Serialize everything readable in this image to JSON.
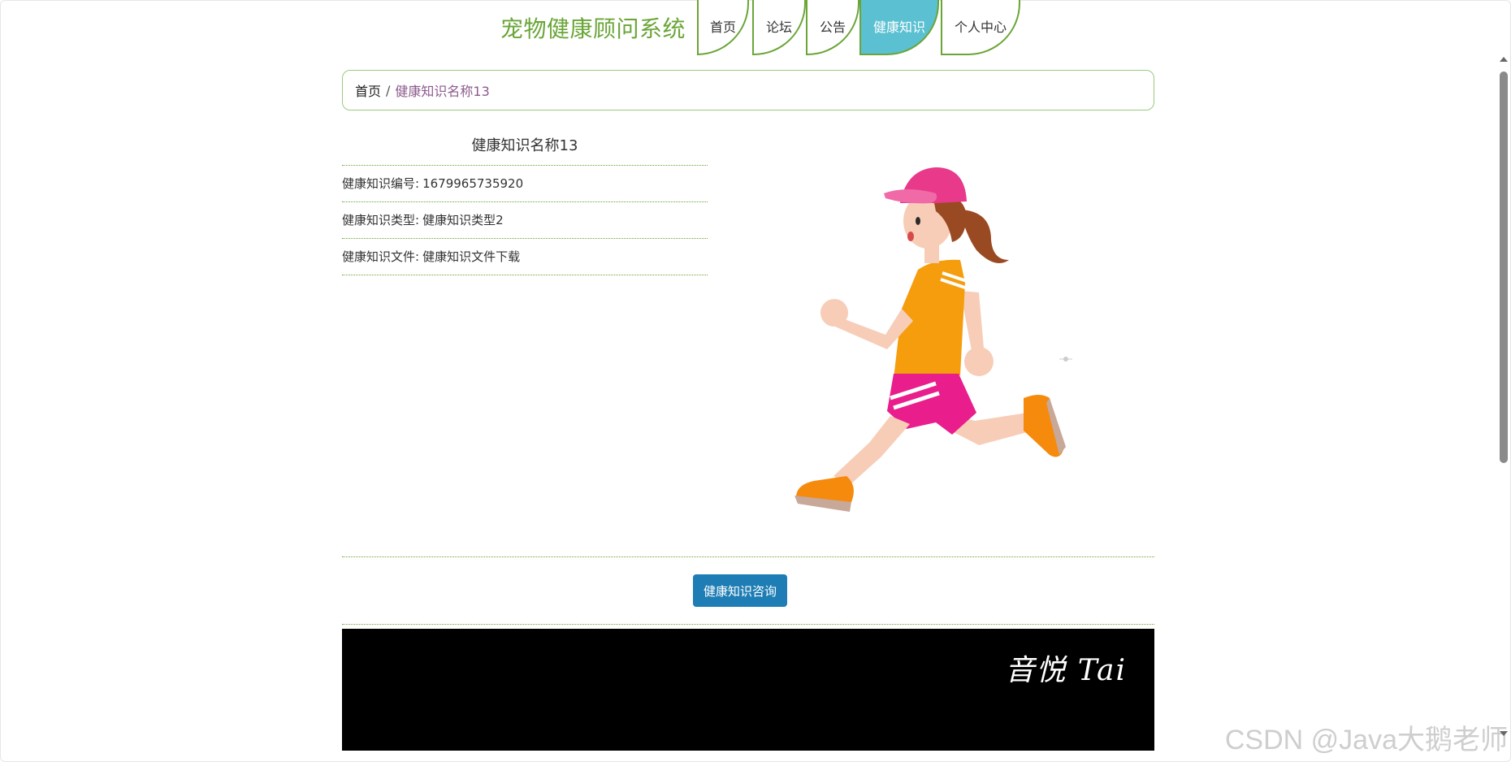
{
  "header": {
    "site_title": "宠物健康顾问系统",
    "nav": [
      {
        "label": "首页",
        "active": false
      },
      {
        "label": "论坛",
        "active": false
      },
      {
        "label": "公告",
        "active": false
      },
      {
        "label": "健康知识",
        "active": true
      },
      {
        "label": "个人中心",
        "active": false
      }
    ]
  },
  "breadcrumb": {
    "home": "首页",
    "separator": "/",
    "current": "健康知识名称13"
  },
  "detail": {
    "title": "健康知识名称13",
    "rows": [
      {
        "label": "健康知识编号:",
        "value": "1679965735920"
      },
      {
        "label": "健康知识类型:",
        "value": "健康知识类型2"
      },
      {
        "label": "健康知识文件:",
        "value": "健康知识文件下载"
      }
    ]
  },
  "actions": {
    "consult_label": "健康知识咨询"
  },
  "banner": {
    "text": "音悦 Tai"
  },
  "watermark": "CSDN @Java大鹅老师",
  "colors": {
    "brand_green": "#6aa537",
    "active_tab": "#5bc0d1",
    "button_blue": "#1e7db4",
    "crumb_current": "#8c5a8c"
  }
}
